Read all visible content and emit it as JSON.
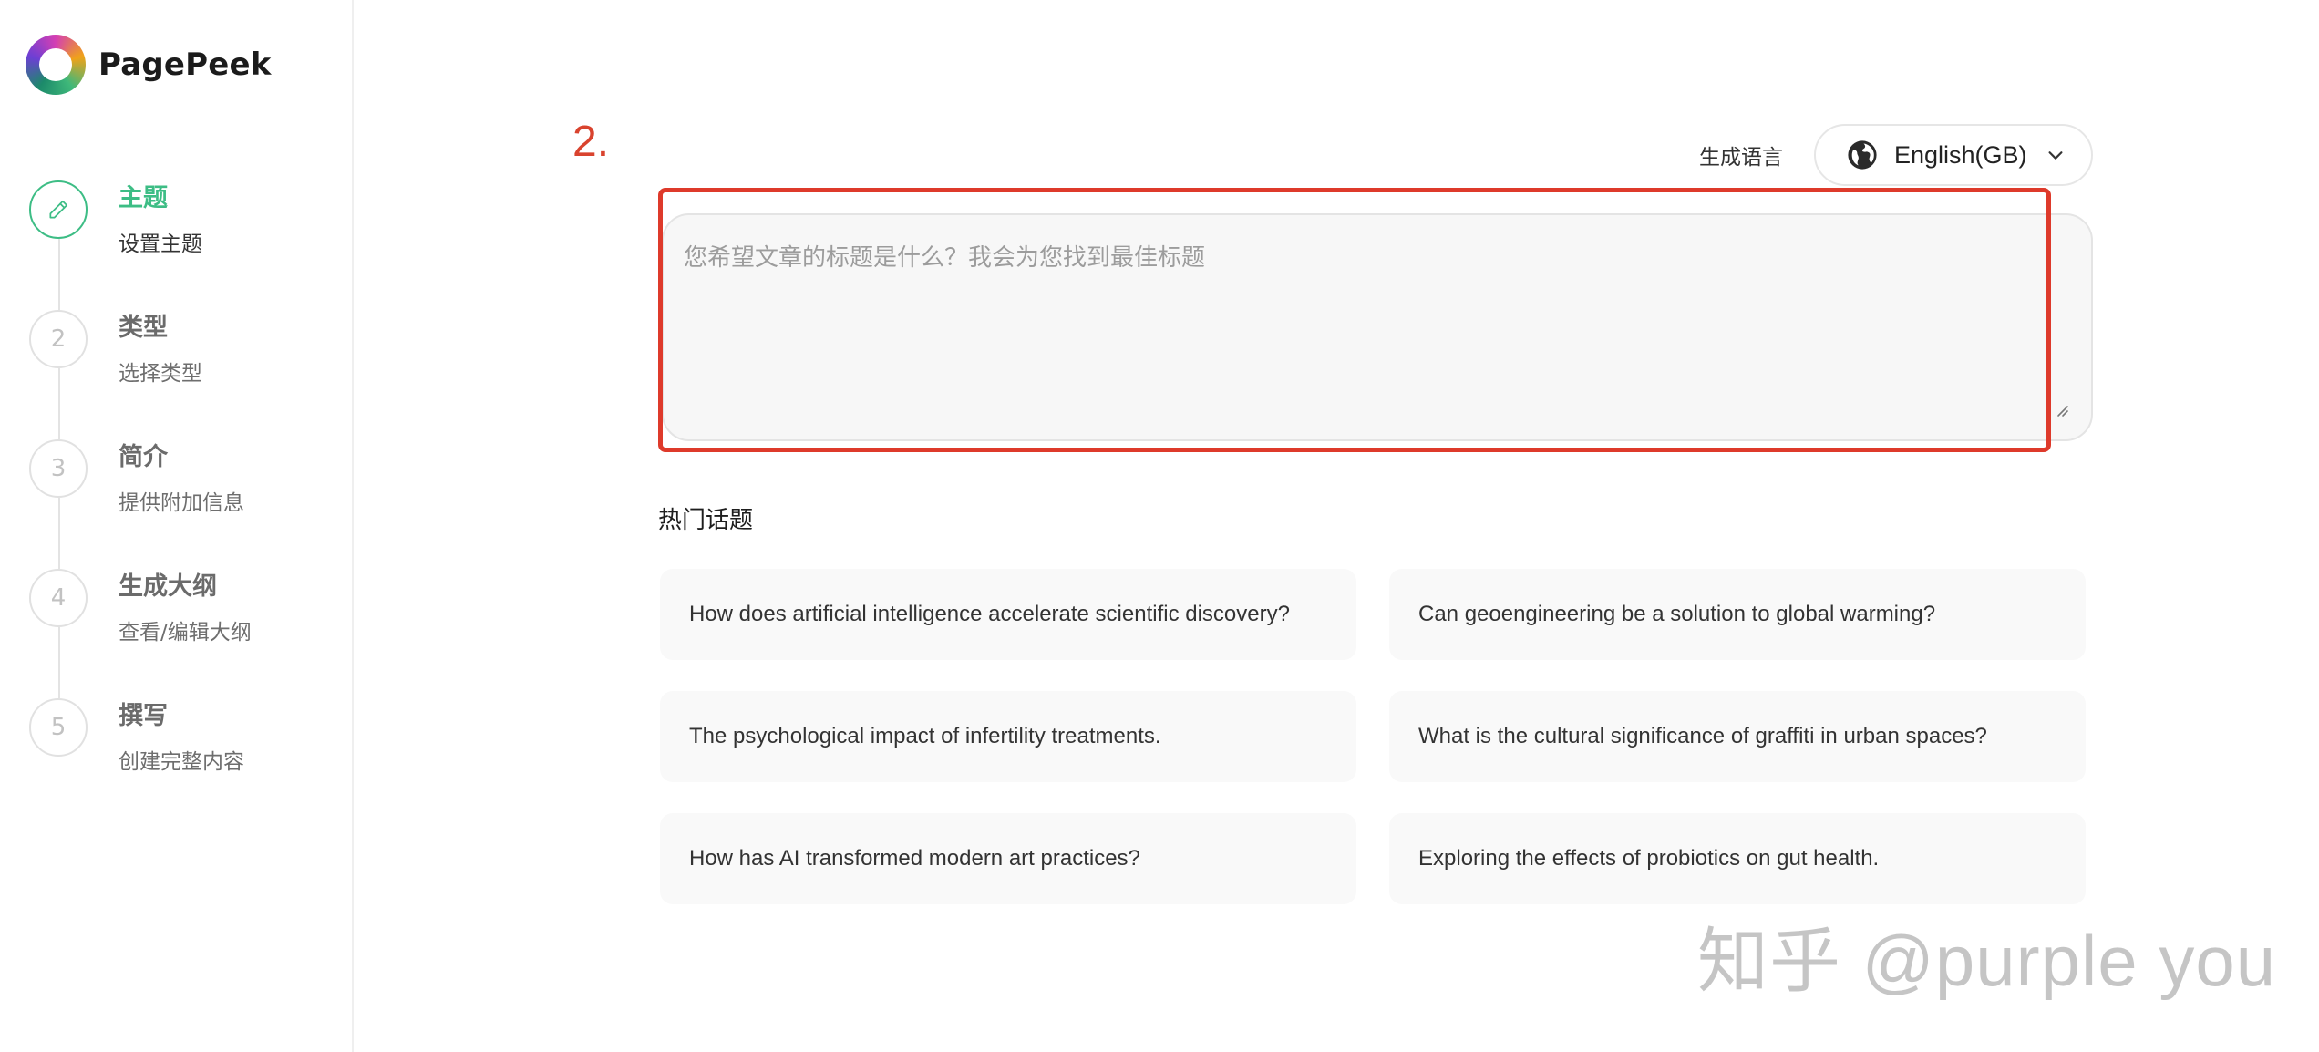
{
  "brand": {
    "name": "PagePeek",
    "logo": "pagepeek-logo"
  },
  "steps": [
    {
      "number": "",
      "icon": "pencil-icon",
      "title": "主题",
      "subtitle": "设置主题",
      "active": true
    },
    {
      "number": "2",
      "title": "类型",
      "subtitle": "选择类型",
      "active": false
    },
    {
      "number": "3",
      "title": "简介",
      "subtitle": "提供附加信息",
      "active": false
    },
    {
      "number": "4",
      "title": "生成大纲",
      "subtitle": "查看/编辑大纲",
      "active": false
    },
    {
      "number": "5",
      "title": "撰写",
      "subtitle": "创建完整内容",
      "active": false
    }
  ],
  "annotation": {
    "number": "2."
  },
  "language": {
    "label": "生成语言",
    "value": "English(GB)",
    "icon": "globe-icon"
  },
  "topic_input": {
    "value": "",
    "placeholder": "您希望文章的标题是什么？我会为您找到最佳标题"
  },
  "hot_topics": {
    "title": "热门话题",
    "items": [
      "How does artificial intelligence accelerate scientific discovery?",
      "Can geoengineering be a solution to global warming?",
      "The psychological impact of infertility treatments.",
      "What is the cultural significance of graffiti in urban spaces?",
      "How has AI transformed modern art practices?",
      "Exploring the effects of probiotics on gut health."
    ]
  },
  "watermark": "知乎 @purple you",
  "colors": {
    "accent": "#3dbd85",
    "highlight": "#de3a2b"
  }
}
